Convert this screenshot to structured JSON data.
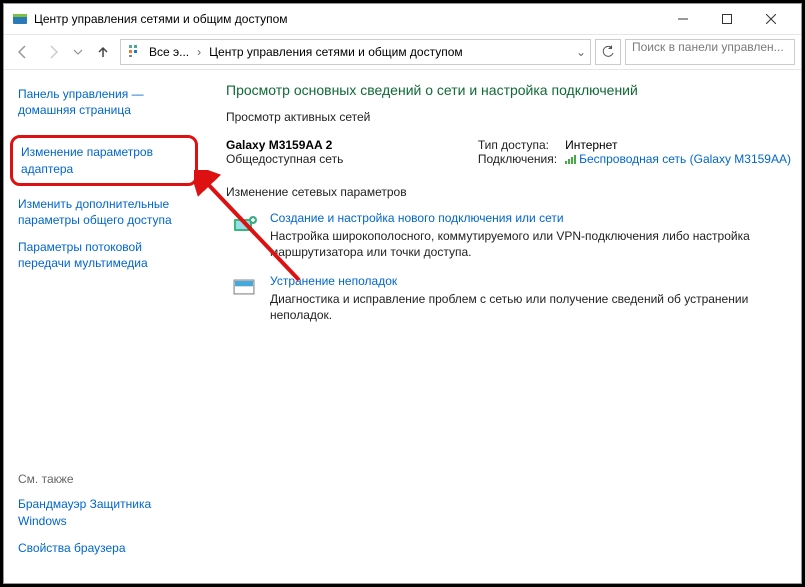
{
  "window": {
    "title": "Центр управления сетями и общим доступом"
  },
  "nav": {
    "crumb1": "Все э...",
    "crumb2": "Центр управления сетями и общим доступом",
    "search_placeholder": "Поиск в панели управлен..."
  },
  "sidebar": {
    "home": "Панель управления — домашняя страница",
    "adapter": "Изменение параметров адаптера",
    "sharing": "Изменить дополнительные параметры общего доступа",
    "streaming": "Параметры потоковой передачи мультимедиа",
    "seealso_label": "См. также",
    "firewall": "Брандмауэр Защитника Windows",
    "browser": "Свойства браузера"
  },
  "main": {
    "heading": "Просмотр основных сведений о сети и настройка подключений",
    "active_legend": "Просмотр активных сетей",
    "net_name": "Galaxy M3159AA 2",
    "net_type": "Общедоступная сеть",
    "access_label": "Тип доступа:",
    "access_value": "Интернет",
    "conn_label": "Подключения:",
    "conn_value": "Беспроводная сеть (Galaxy M3159AA)",
    "change_legend": "Изменение сетевых параметров",
    "task1_title": "Создание и настройка нового подключения или сети",
    "task1_desc": "Настройка широкополосного, коммутируемого или VPN-подключения либо настройка маршрутизатора или точки доступа.",
    "task2_title": "Устранение неполадок",
    "task2_desc": "Диагностика и исправление проблем с сетью или получение сведений об устранении неполадок."
  }
}
